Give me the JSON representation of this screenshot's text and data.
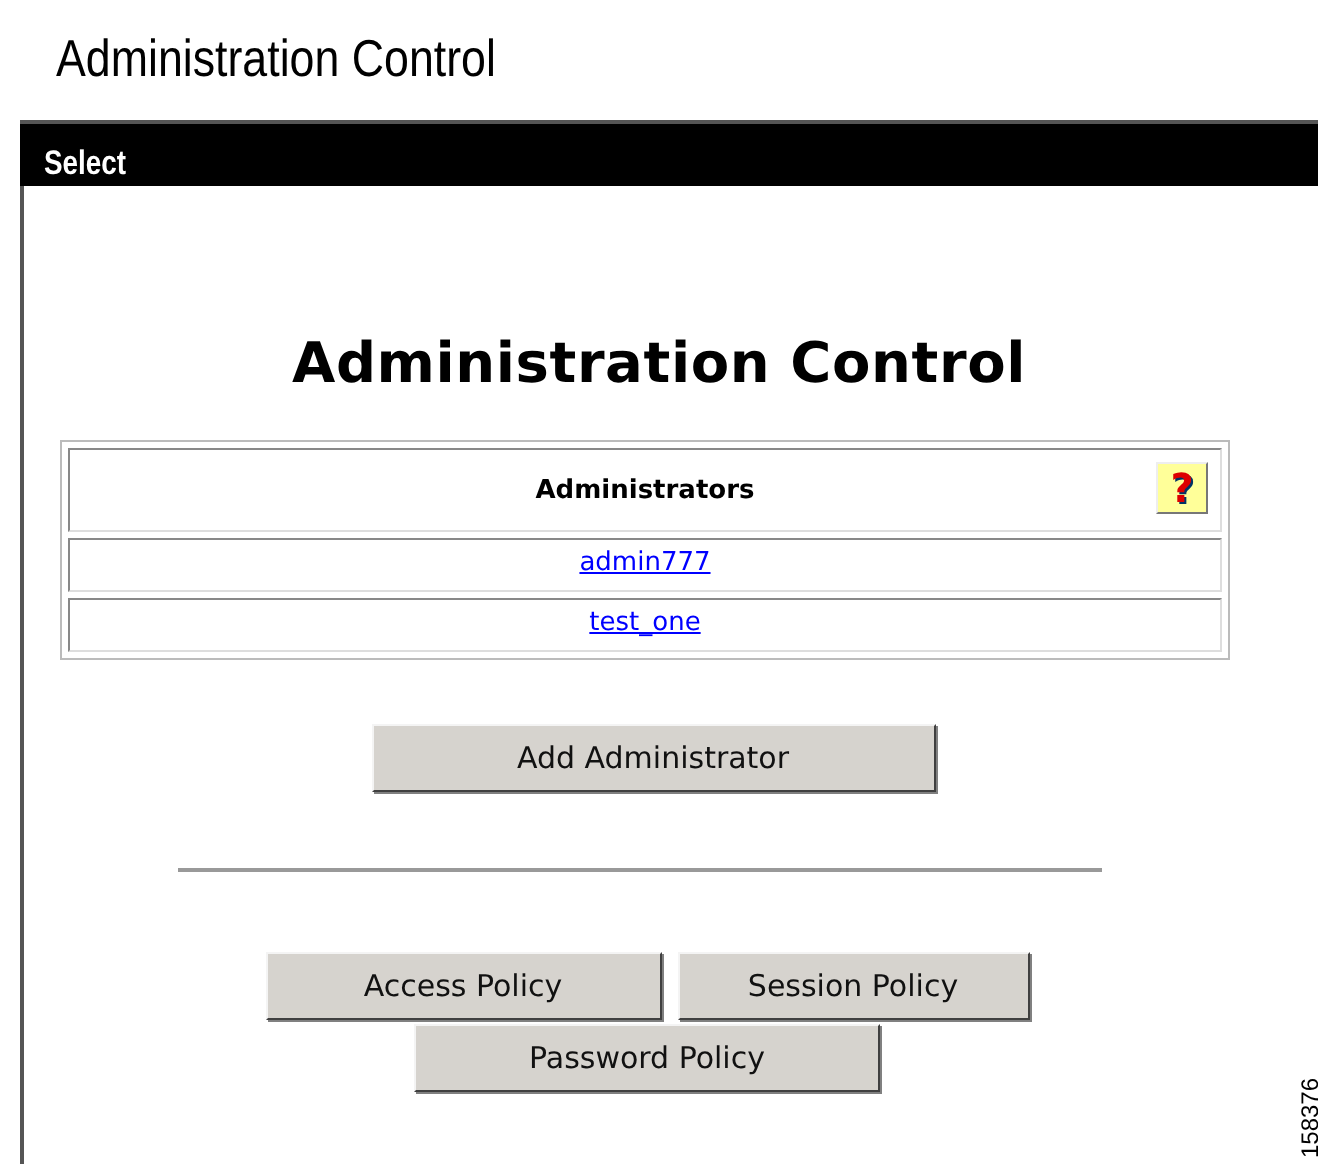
{
  "page_title": "Administration Control",
  "select_bar": {
    "title": "Select"
  },
  "heading": "Administration Control",
  "administrators": {
    "header": "Administrators",
    "help": "?",
    "rows": [
      {
        "name": "admin777"
      },
      {
        "name": "test_one"
      }
    ]
  },
  "add_button": "Add Administrator",
  "policy_buttons": [
    "Access Policy",
    "Session Policy",
    "Password Policy"
  ],
  "figure_number": "158376"
}
